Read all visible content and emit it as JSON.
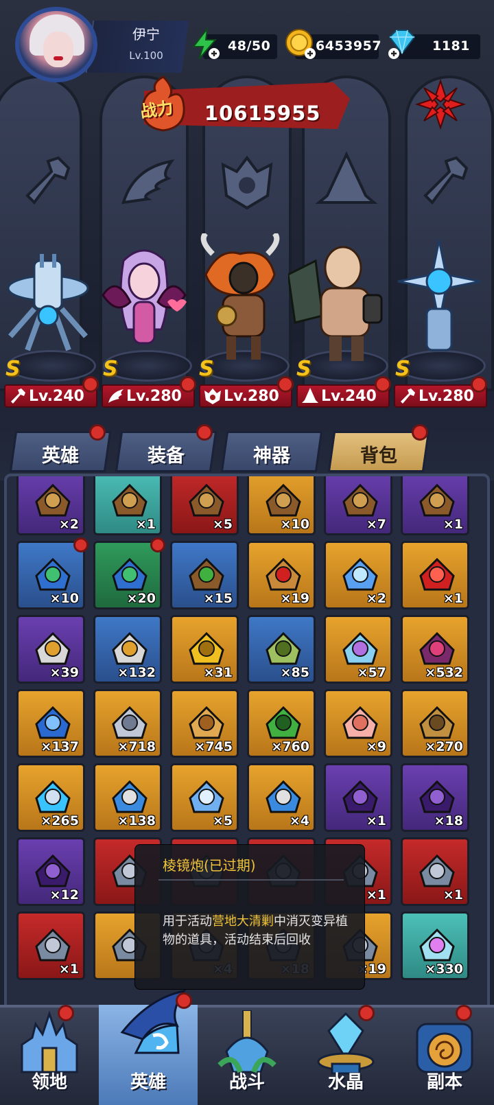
{
  "player": {
    "name": "伊宁",
    "level": "Lv.100"
  },
  "resources": {
    "stamina": "48/50",
    "gold": "6453957",
    "diamonds": "1181"
  },
  "power": {
    "label": "战力",
    "value": "10615955"
  },
  "heroes": [
    {
      "rank": "S",
      "level": "Lv.240",
      "class_icon": "wrench-icon"
    },
    {
      "rank": "S",
      "level": "Lv.280",
      "class_icon": "wing-icon"
    },
    {
      "rank": "S",
      "level": "Lv.280",
      "class_icon": "beast-icon"
    },
    {
      "rank": "S",
      "level": "Lv.240",
      "class_icon": "wizard-hat-icon"
    },
    {
      "rank": "S",
      "level": "Lv.280",
      "class_icon": "wrench-icon"
    }
  ],
  "tabs": [
    "英雄",
    "装备",
    "神器",
    "背包"
  ],
  "active_tab": "背包",
  "inventory": [
    {
      "qty": "×2",
      "rarity": "purple",
      "icon": "chest-icon"
    },
    {
      "qty": "×1",
      "rarity": "teal",
      "icon": "chest-icon"
    },
    {
      "qty": "×5",
      "rarity": "red",
      "icon": "chest-icon"
    },
    {
      "qty": "×10",
      "rarity": "orange",
      "icon": "chest-icon"
    },
    {
      "qty": "×7",
      "rarity": "purple",
      "icon": "chest-icon"
    },
    {
      "qty": "×1",
      "rarity": "purple",
      "icon": "chest-icon"
    },
    {
      "qty": "×10",
      "rarity": "blue",
      "icon": "gem-chest-icon"
    },
    {
      "qty": "×20",
      "rarity": "green",
      "icon": "gem-chest-icon"
    },
    {
      "qty": "×15",
      "rarity": "blue",
      "icon": "plant-chest-icon"
    },
    {
      "qty": "×19",
      "rarity": "orange",
      "icon": "rose-letter-icon"
    },
    {
      "qty": "×2",
      "rarity": "orange",
      "icon": "crystal-ticket-icon"
    },
    {
      "qty": "×1",
      "rarity": "orange",
      "icon": "red-dragon-icon"
    },
    {
      "qty": "×39",
      "rarity": "purple",
      "icon": "scroll-icon"
    },
    {
      "qty": "×132",
      "rarity": "blue",
      "icon": "scroll-icon"
    },
    {
      "qty": "×31",
      "rarity": "orange",
      "icon": "yellow-seed-icon"
    },
    {
      "qty": "×85",
      "rarity": "blue",
      "icon": "green-seed-icon"
    },
    {
      "qty": "×57",
      "rarity": "orange",
      "icon": "crystal-shard-icon"
    },
    {
      "qty": "×532",
      "rarity": "orange",
      "icon": "love-letter-icon"
    },
    {
      "qty": "×137",
      "rarity": "orange",
      "icon": "blue-hat-icon"
    },
    {
      "qty": "×718",
      "rarity": "orange",
      "icon": "satellite-icon"
    },
    {
      "qty": "×745",
      "rarity": "orange",
      "icon": "gourd-icon"
    },
    {
      "qty": "×760",
      "rarity": "orange",
      "icon": "sprout-icon"
    },
    {
      "qty": "×9",
      "rarity": "orange",
      "icon": "peach-icon"
    },
    {
      "qty": "×270",
      "rarity": "orange",
      "icon": "pagoda-icon"
    },
    {
      "qty": "×265",
      "rarity": "orange",
      "icon": "orb-ring-icon"
    },
    {
      "qty": "×138",
      "rarity": "orange",
      "icon": "cannon-icon"
    },
    {
      "qty": "×5",
      "rarity": "orange",
      "icon": "feather-icon"
    },
    {
      "qty": "×4",
      "rarity": "orange",
      "icon": "cannon-icon"
    },
    {
      "qty": "×1",
      "rarity": "purple",
      "icon": "wizard-hat-badge-icon"
    },
    {
      "qty": "×18",
      "rarity": "purple",
      "icon": "beast-badge-icon"
    },
    {
      "qty": "×12",
      "rarity": "purple",
      "icon": "wrench-badge-icon"
    },
    {
      "qty": "",
      "rarity": "red",
      "icon": "puzzle-icon"
    },
    {
      "qty": "",
      "rarity": "red",
      "icon": "puzzle-icon"
    },
    {
      "qty": "",
      "rarity": "red",
      "icon": "puzzle-icon"
    },
    {
      "qty": "×1",
      "rarity": "red",
      "icon": "puzzle-icon"
    },
    {
      "qty": "×1",
      "rarity": "red",
      "icon": "puzzle-icon"
    },
    {
      "qty": "×1",
      "rarity": "red",
      "icon": "puzzle-icon"
    },
    {
      "qty": "",
      "rarity": "orange",
      "icon": "puzzle-icon"
    },
    {
      "qty": "×4",
      "rarity": "orange",
      "icon": "puzzle-icon"
    },
    {
      "qty": "×18",
      "rarity": "orange",
      "icon": "puzzle-icon"
    },
    {
      "qty": "×19",
      "rarity": "orange",
      "icon": "puzzle-icon"
    },
    {
      "qty": "×330",
      "rarity": "teal",
      "icon": "rainbow-crystal-icon"
    }
  ],
  "tooltip": {
    "title": "棱镜炮(已过期)",
    "desc_1": "用于活动",
    "desc_highlight": "营地大清剿",
    "desc_2": "中消灭变异植物的道具，活动结束后回收"
  },
  "nav": [
    "领地",
    "英雄",
    "战斗",
    "水晶",
    "副本"
  ],
  "active_nav": "英雄"
}
